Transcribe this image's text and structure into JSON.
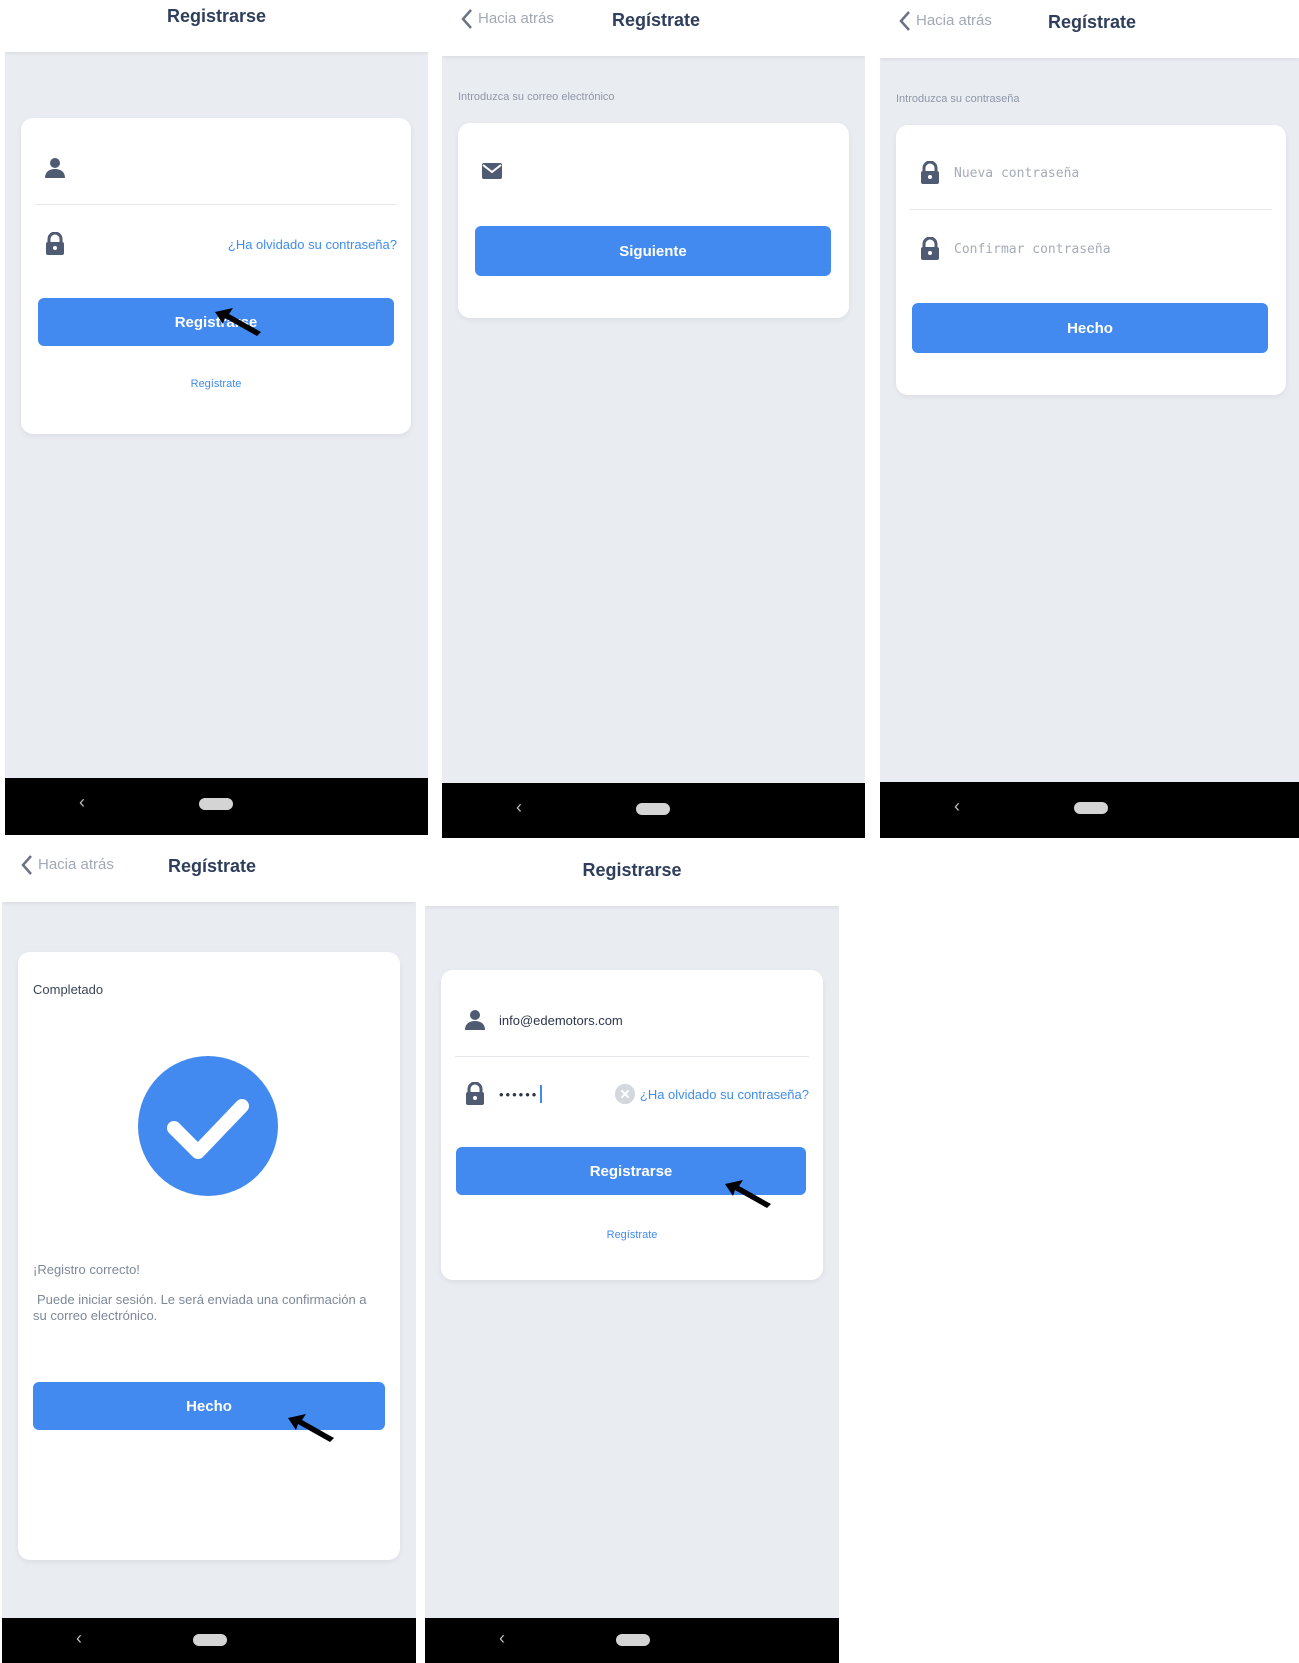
{
  "screen1": {
    "title": "Registrarse",
    "forgot_link": "¿Ha olvidado su contraseña?",
    "submit_button": "Registrarse",
    "register_link": "Regístrate"
  },
  "screen2": {
    "back_label": "Hacia atrás",
    "title": "Regístrate",
    "instruction": "Introduzca su correo electrónico",
    "next_button": "Siguiente"
  },
  "screen3": {
    "back_label": "Hacia atrás",
    "title": "Regístrate",
    "instruction": "Introduzca su contraseña",
    "new_password_placeholder": "Nueva contraseña",
    "confirm_password_placeholder": "Confirmar contraseña",
    "done_button": "Hecho"
  },
  "screen4": {
    "back_label": "Hacia atrás",
    "title": "Regístrate",
    "status_label": "Completado",
    "success_title": "¡Registro correcto!",
    "success_message": "Puede iniciar sesión. Le será enviada una confirmación a su correo electrónico.",
    "done_button": "Hecho"
  },
  "screen5": {
    "title": "Registrarse",
    "email_value": "info@edemotors.com",
    "password_value": "••••••",
    "forgot_link": "¿Ha olvidado su contraseña?",
    "submit_button": "Registrarse",
    "register_link": "Regístrate"
  },
  "colors": {
    "accent": "#438af0",
    "background": "#e9ecf1",
    "nav_bar": "#000000"
  }
}
